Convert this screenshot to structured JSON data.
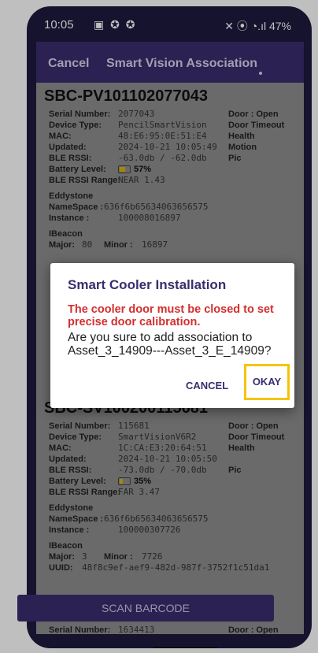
{
  "status": {
    "time": "10:05",
    "left_icons": "▣ ✪ ✪",
    "right_icons": "✕ ⦿ ◔.ıl",
    "battery": "47%"
  },
  "appbar": {
    "cancel": "Cancel",
    "title": "Smart Vision Association"
  },
  "devices": [
    {
      "name": "SBC-PV101102077043",
      "serial_label": "Serial Number:",
      "serial": "2077043",
      "type_label": "Device Type:",
      "type": "PencilSmartVision",
      "mac_label": "MAC:",
      "mac": "48:E6:95:0E:51:E4",
      "updated_label": "Updated:",
      "updated": "2024-10-21 10:05:49",
      "rssi_label": "BLE RSSI:",
      "rssi": "-63.0db / -62.0db",
      "battery_label": "Battery Level:",
      "battery": "57%",
      "battery_fraction": 0.57,
      "range_label": "BLE RSSI Range:",
      "range": "NEAR 1.43",
      "right": [
        "Door : Open",
        "Door Timeout",
        "Health",
        "Motion",
        "Pic"
      ],
      "eddystone": "Eddystone",
      "namespace_label": "NameSpace :",
      "namespace": "636f6b65634063656575",
      "instance_label": "Instance :",
      "instance": "100008016897",
      "ibeacon": "IBeacon",
      "major_label": "Major:",
      "major": "80",
      "minor_label": "Minor :",
      "minor": "16897"
    },
    {
      "name": "SBC-SV100200115681",
      "serial_label": "Serial Number:",
      "serial": "115681",
      "type_label": "Device Type:",
      "type": "SmartVisionV6R2",
      "mac_label": "MAC:",
      "mac": "1C:CA:E3:20:64:51",
      "updated_label": "Updated:",
      "updated": "2024-10-21 10:05:50",
      "rssi_label": "BLE RSSI:",
      "rssi": "-73.0db / -70.0db",
      "battery_label": "Battery Level:",
      "battery": "35%",
      "battery_fraction": 0.35,
      "range_label": "BLE RSSI Range:",
      "range": "FAR 3.47",
      "right": [
        "Door : Open",
        "Door Timeout",
        "Health",
        "",
        "Pic"
      ],
      "eddystone": "Eddystone",
      "namespace_label": "NameSpace :",
      "namespace": "636f6b65634063656575",
      "instance_label": "Instance :",
      "instance": "100000307726",
      "ibeacon": "IBeacon",
      "major_label": "Major:",
      "major": "3",
      "minor_label": "Minor :",
      "minor": "7726",
      "uuid_label": "UUID:",
      "uuid": "48f8c9ef-aef9-482d-987f-3752f1c51da1"
    }
  ],
  "third_partial": {
    "serial_label": "Serial Number:",
    "serial": "1634413",
    "door": "Door : Open"
  },
  "scan_button": "SCAN BARCODE",
  "dialog": {
    "title": "Smart Cooler Installation",
    "warning": "The cooler door must be closed to set precise door calibration.",
    "message": "Are you sure to add association to Asset_3_14909---Asset_3_E_14909?",
    "cancel": "CANCEL",
    "okay": "OKAY"
  },
  "colors": {
    "primary": "#3a2d6e",
    "warning": "#d32f2f",
    "highlight": "#f5c400"
  }
}
